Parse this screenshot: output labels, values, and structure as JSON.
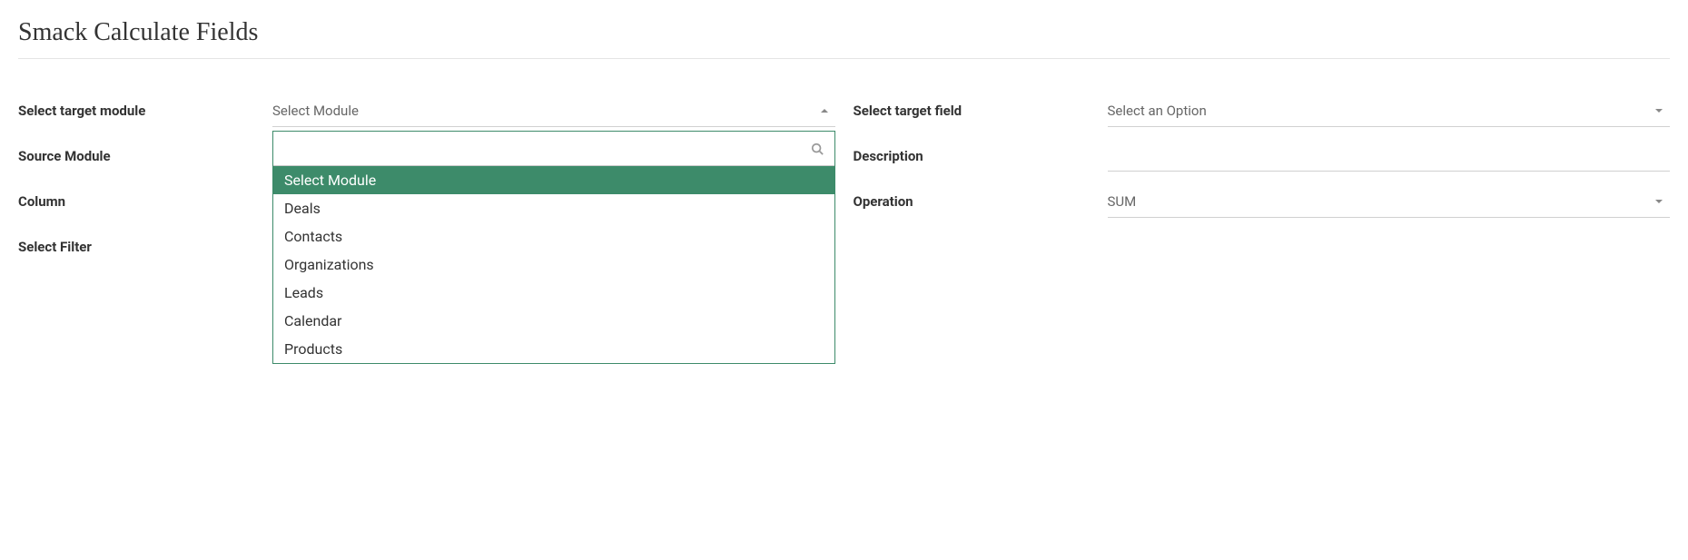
{
  "page": {
    "title": "Smack Calculate Fields"
  },
  "labels": {
    "target_module": "Select target module",
    "source_module": "Source Module",
    "column": "Column",
    "select_filter": "Select Filter",
    "target_field": "Select target field",
    "description": "Description",
    "operation": "Operation"
  },
  "fields": {
    "target_module": {
      "placeholder": "Select Module",
      "search_value": "",
      "options": [
        "Select Module",
        "Deals",
        "Contacts",
        "Organizations",
        "Leads",
        "Calendar",
        "Products"
      ],
      "highlighted_index": 0
    },
    "target_field": {
      "placeholder": "Select an Option"
    },
    "description": {
      "value": ""
    },
    "operation": {
      "value": "SUM"
    }
  }
}
